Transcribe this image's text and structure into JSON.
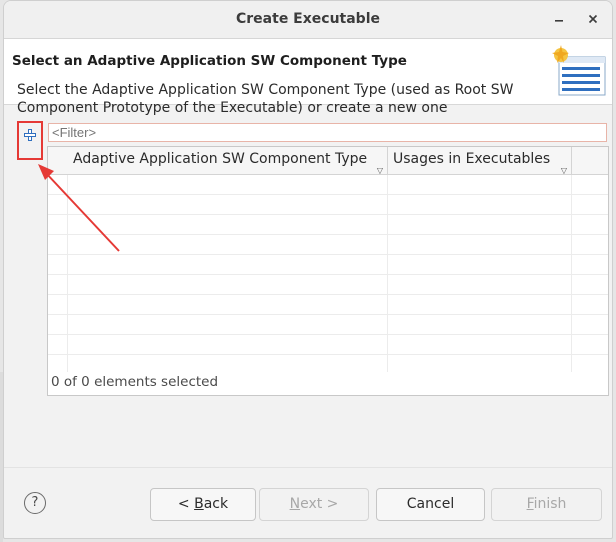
{
  "window": {
    "title": "Create Executable"
  },
  "header": {
    "title": "Select an Adaptive Application SW Component Type",
    "description": "Select the Adaptive Application SW Component Type (used as Root SW Component Prototype of the Executable) or create a new one",
    "icon": "wizard-banner-icon"
  },
  "toolbar": {
    "add_icon": "plus-icon"
  },
  "filter": {
    "placeholder": "<Filter>",
    "value": ""
  },
  "table": {
    "columns": [
      {
        "label": "Adaptive Application SW Component Type"
      },
      {
        "label": "Usages in Executables"
      }
    ],
    "rows": [],
    "status": "0 of 0 elements selected"
  },
  "buttons": {
    "back": {
      "prefix": "< ",
      "mnemonic": "B",
      "rest": "ack"
    },
    "next": {
      "mnemonic": "N",
      "rest": "ext >"
    },
    "cancel": "Cancel",
    "finish": {
      "mnemonic": "F",
      "rest": "inish"
    }
  },
  "colors": {
    "highlight": "#e53935",
    "dialog_bg": "#f2f2f2",
    "add_icon_blue": "#2f6fbf"
  }
}
